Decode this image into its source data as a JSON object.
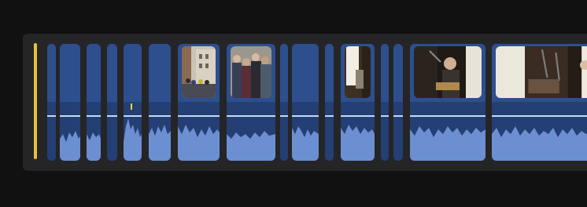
{
  "timeline": {
    "clips": [
      {
        "id": "c1",
        "kind": "blank"
      },
      {
        "id": "c2",
        "kind": "blank"
      },
      {
        "id": "c3",
        "kind": "blank"
      },
      {
        "id": "c4",
        "kind": "blank"
      },
      {
        "id": "c5",
        "kind": "blank"
      },
      {
        "id": "c6",
        "kind": "blank"
      },
      {
        "id": "c7",
        "kind": "photo",
        "thumbnail": "street-buildings-thumbnail"
      },
      {
        "id": "c8",
        "kind": "photo",
        "thumbnail": "crowd-group-thumbnail"
      },
      {
        "id": "c9",
        "kind": "blank"
      },
      {
        "id": "c10",
        "kind": "blank"
      },
      {
        "id": "c11",
        "kind": "blank"
      },
      {
        "id": "c12",
        "kind": "photo",
        "thumbnail": "window-light-thumbnail"
      },
      {
        "id": "c13",
        "kind": "blank"
      },
      {
        "id": "c14",
        "kind": "blank"
      },
      {
        "id": "c15",
        "kind": "photo",
        "thumbnail": "singer-guitar-thumbnail"
      },
      {
        "id": "c16",
        "kind": "photo",
        "thumbnail": "studio-microphones-thumbnail"
      }
    ]
  },
  "colors": {
    "background": "#111111",
    "track": "#252527",
    "clip": "#2e4f8e",
    "audio": "#243f73",
    "waveform": "#6b8fd1",
    "playhead": "#e6c13a"
  },
  "icons": [
    "playhead-icon",
    "marker-icon"
  ]
}
